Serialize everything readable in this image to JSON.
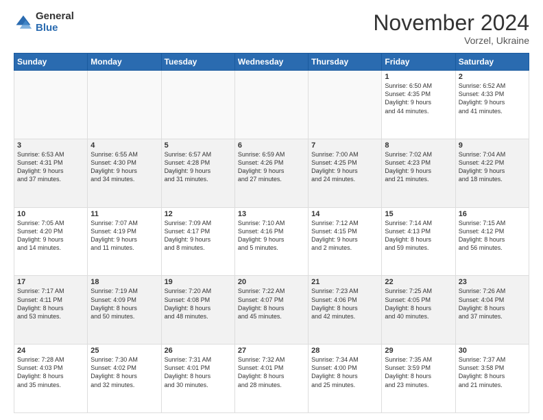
{
  "logo": {
    "general": "General",
    "blue": "Blue"
  },
  "header": {
    "title": "November 2024",
    "subtitle": "Vorzel, Ukraine"
  },
  "days_of_week": [
    "Sunday",
    "Monday",
    "Tuesday",
    "Wednesday",
    "Thursday",
    "Friday",
    "Saturday"
  ],
  "weeks": [
    [
      {
        "day": "",
        "info": ""
      },
      {
        "day": "",
        "info": ""
      },
      {
        "day": "",
        "info": ""
      },
      {
        "day": "",
        "info": ""
      },
      {
        "day": "",
        "info": ""
      },
      {
        "day": "1",
        "info": "Sunrise: 6:50 AM\nSunset: 4:35 PM\nDaylight: 9 hours\nand 44 minutes."
      },
      {
        "day": "2",
        "info": "Sunrise: 6:52 AM\nSunset: 4:33 PM\nDaylight: 9 hours\nand 41 minutes."
      }
    ],
    [
      {
        "day": "3",
        "info": "Sunrise: 6:53 AM\nSunset: 4:31 PM\nDaylight: 9 hours\nand 37 minutes."
      },
      {
        "day": "4",
        "info": "Sunrise: 6:55 AM\nSunset: 4:30 PM\nDaylight: 9 hours\nand 34 minutes."
      },
      {
        "day": "5",
        "info": "Sunrise: 6:57 AM\nSunset: 4:28 PM\nDaylight: 9 hours\nand 31 minutes."
      },
      {
        "day": "6",
        "info": "Sunrise: 6:59 AM\nSunset: 4:26 PM\nDaylight: 9 hours\nand 27 minutes."
      },
      {
        "day": "7",
        "info": "Sunrise: 7:00 AM\nSunset: 4:25 PM\nDaylight: 9 hours\nand 24 minutes."
      },
      {
        "day": "8",
        "info": "Sunrise: 7:02 AM\nSunset: 4:23 PM\nDaylight: 9 hours\nand 21 minutes."
      },
      {
        "day": "9",
        "info": "Sunrise: 7:04 AM\nSunset: 4:22 PM\nDaylight: 9 hours\nand 18 minutes."
      }
    ],
    [
      {
        "day": "10",
        "info": "Sunrise: 7:05 AM\nSunset: 4:20 PM\nDaylight: 9 hours\nand 14 minutes."
      },
      {
        "day": "11",
        "info": "Sunrise: 7:07 AM\nSunset: 4:19 PM\nDaylight: 9 hours\nand 11 minutes."
      },
      {
        "day": "12",
        "info": "Sunrise: 7:09 AM\nSunset: 4:17 PM\nDaylight: 9 hours\nand 8 minutes."
      },
      {
        "day": "13",
        "info": "Sunrise: 7:10 AM\nSunset: 4:16 PM\nDaylight: 9 hours\nand 5 minutes."
      },
      {
        "day": "14",
        "info": "Sunrise: 7:12 AM\nSunset: 4:15 PM\nDaylight: 9 hours\nand 2 minutes."
      },
      {
        "day": "15",
        "info": "Sunrise: 7:14 AM\nSunset: 4:13 PM\nDaylight: 8 hours\nand 59 minutes."
      },
      {
        "day": "16",
        "info": "Sunrise: 7:15 AM\nSunset: 4:12 PM\nDaylight: 8 hours\nand 56 minutes."
      }
    ],
    [
      {
        "day": "17",
        "info": "Sunrise: 7:17 AM\nSunset: 4:11 PM\nDaylight: 8 hours\nand 53 minutes."
      },
      {
        "day": "18",
        "info": "Sunrise: 7:19 AM\nSunset: 4:09 PM\nDaylight: 8 hours\nand 50 minutes."
      },
      {
        "day": "19",
        "info": "Sunrise: 7:20 AM\nSunset: 4:08 PM\nDaylight: 8 hours\nand 48 minutes."
      },
      {
        "day": "20",
        "info": "Sunrise: 7:22 AM\nSunset: 4:07 PM\nDaylight: 8 hours\nand 45 minutes."
      },
      {
        "day": "21",
        "info": "Sunrise: 7:23 AM\nSunset: 4:06 PM\nDaylight: 8 hours\nand 42 minutes."
      },
      {
        "day": "22",
        "info": "Sunrise: 7:25 AM\nSunset: 4:05 PM\nDaylight: 8 hours\nand 40 minutes."
      },
      {
        "day": "23",
        "info": "Sunrise: 7:26 AM\nSunset: 4:04 PM\nDaylight: 8 hours\nand 37 minutes."
      }
    ],
    [
      {
        "day": "24",
        "info": "Sunrise: 7:28 AM\nSunset: 4:03 PM\nDaylight: 8 hours\nand 35 minutes."
      },
      {
        "day": "25",
        "info": "Sunrise: 7:30 AM\nSunset: 4:02 PM\nDaylight: 8 hours\nand 32 minutes."
      },
      {
        "day": "26",
        "info": "Sunrise: 7:31 AM\nSunset: 4:01 PM\nDaylight: 8 hours\nand 30 minutes."
      },
      {
        "day": "27",
        "info": "Sunrise: 7:32 AM\nSunset: 4:01 PM\nDaylight: 8 hours\nand 28 minutes."
      },
      {
        "day": "28",
        "info": "Sunrise: 7:34 AM\nSunset: 4:00 PM\nDaylight: 8 hours\nand 25 minutes."
      },
      {
        "day": "29",
        "info": "Sunrise: 7:35 AM\nSunset: 3:59 PM\nDaylight: 8 hours\nand 23 minutes."
      },
      {
        "day": "30",
        "info": "Sunrise: 7:37 AM\nSunset: 3:58 PM\nDaylight: 8 hours\nand 21 minutes."
      }
    ]
  ]
}
